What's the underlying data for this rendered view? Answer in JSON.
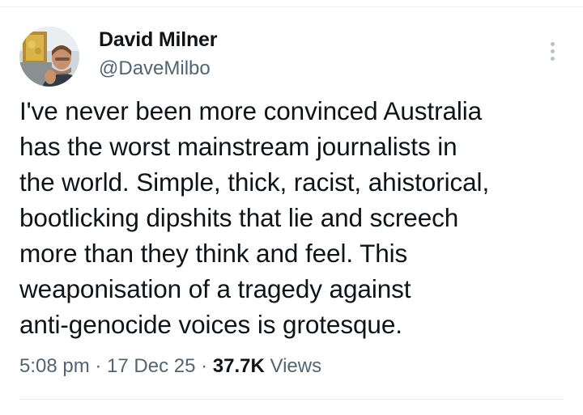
{
  "author": {
    "name": "David Milner",
    "handle": "@DaveMilbo"
  },
  "tweet": {
    "lines": [
      "I've never been more convinced Australia",
      "has the worst mainstream journalists in",
      "the world. Simple, thick, racist, ahistorical,",
      "bootlicking dipshits that lie and screech",
      "more than they think and feel. This",
      "weaponisation of a tragedy against",
      "anti-genocide voices is grotesque."
    ]
  },
  "meta": {
    "time": "5:08 pm",
    "separator": " · ",
    "date": "17 Dec 25",
    "views_count": "37.7K",
    "views_label": "Views"
  },
  "icons": {
    "more": "more-vertical-icon",
    "avatar": "avatar-photo"
  },
  "colors": {
    "text": "#0f1419",
    "secondary": "#536471",
    "divider": "#eff3f4"
  }
}
